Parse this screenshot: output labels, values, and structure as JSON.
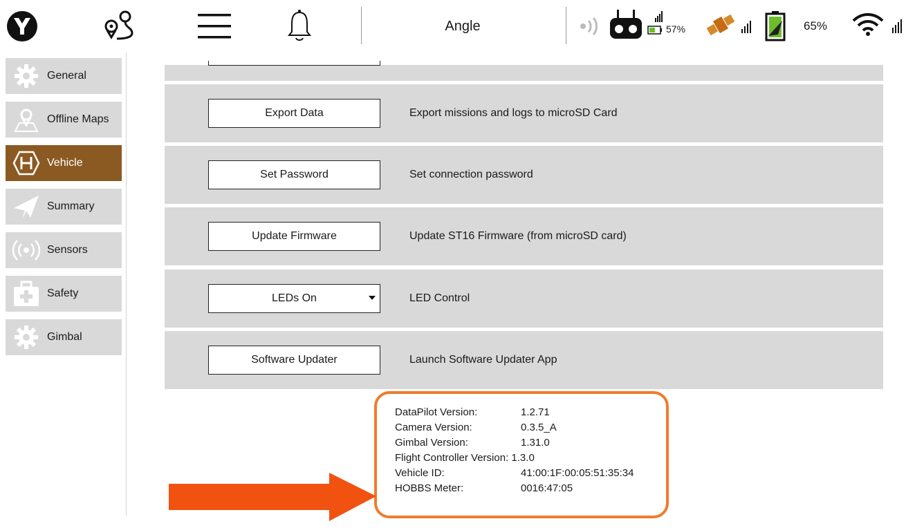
{
  "topbar": {
    "mode": "Angle",
    "controller_battery": "57%",
    "vehicle_battery": "65%",
    "icons": [
      "app-logo-icon",
      "map-pin-icon",
      "menu-icon",
      "bell-icon",
      "signal-icon",
      "controller-icon",
      "battery-icon",
      "gps-icon",
      "vehicle-battery-icon",
      "wifi-icon"
    ],
    "battery_green": "#6dbe2b"
  },
  "sidebar": {
    "items": [
      {
        "label": "General",
        "icon": "gear-icon"
      },
      {
        "label": "Offline Maps",
        "icon": "map-icon"
      },
      {
        "label": "Vehicle",
        "icon": "hexagon-h-icon",
        "active": true
      },
      {
        "label": "Summary",
        "icon": "paper-plane-icon"
      },
      {
        "label": "Sensors",
        "icon": "sensor-icon"
      },
      {
        "label": "Safety",
        "icon": "first-aid-icon"
      },
      {
        "label": "Gimbal",
        "icon": "gear-icon"
      }
    ],
    "active_color": "#8b5a22"
  },
  "rows": [
    {
      "button": "Export Data",
      "description": "Export missions and logs to microSD Card"
    },
    {
      "button": "Set Password",
      "description": "Set connection password"
    },
    {
      "button": "Update Firmware",
      "description": "Update ST16 Firmware (from microSD card)"
    },
    {
      "button": "LEDs On",
      "description": "LED Control"
    },
    {
      "button": "Software Updater",
      "description": "Launch Software Updater App"
    }
  ],
  "versions": [
    {
      "label": "DataPilot Version:",
      "value": "1.2.71"
    },
    {
      "label": "Camera Version:",
      "value": "0.3.5_A"
    },
    {
      "label": "Gimbal Version:",
      "value": "1.31.0"
    },
    {
      "label": "Flight Controller Version:",
      "value": "1.3.0"
    },
    {
      "label": "Vehicle ID:",
      "value": "41:00:1F:00:05:51:35:34"
    },
    {
      "label": "HOBBS Meter:",
      "value": "0016:47:05"
    }
  ],
  "highlight_color": "#f07c2c",
  "arrow_color": "#f2520f"
}
